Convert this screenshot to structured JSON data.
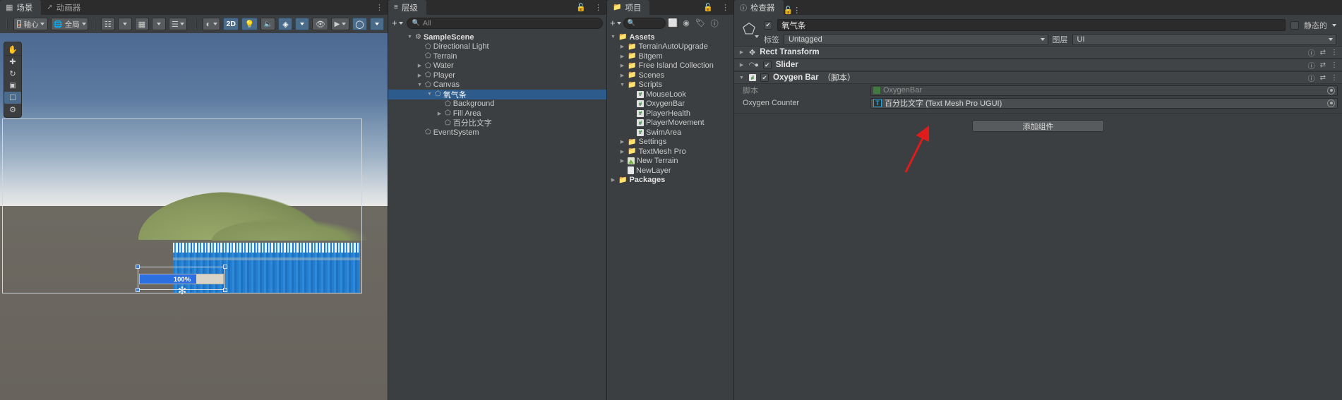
{
  "scene": {
    "tabs": [
      {
        "label": "场景",
        "icon": "grid-icon",
        "active": true
      },
      {
        "label": "动画器",
        "icon": "animator-icon",
        "active": false
      }
    ],
    "toolbar": {
      "pivot_label": "轴心",
      "global_label": "全局",
      "grid_icon": "grid-snap-icon",
      "snap_icon": "snap-increment-icon",
      "ruler_icon": "ruler-icon",
      "shading_icon": "shading-mode-icon",
      "twod_label": "2D",
      "light_icon": "lighting-icon",
      "audio_icon": "audio-mute-icon",
      "fx_icon": "effects-icon",
      "hidden_icon": "visibility-off-icon",
      "camera_icon": "scene-camera-icon",
      "gizmo_icon": "gizmos-icon"
    },
    "tools": [
      "hand-tool",
      "move-tool",
      "rotate-tool",
      "scale-tool",
      "rect-tool",
      "transform-tool"
    ],
    "slider_value": "100%",
    "menu_icon": "kebab-menu-icon"
  },
  "hierarchy": {
    "tab_label": "层级",
    "tab_icon": "hierarchy-icon",
    "add_label": "+",
    "search_placeholder": "All",
    "search_value": "",
    "lock_icon": "lock-icon",
    "menu_icon": "kebab-menu-icon",
    "items": [
      {
        "label": "SampleScene",
        "depth": 0,
        "tri": "down",
        "icon": "scene-icon",
        "bold": true,
        "selected": false
      },
      {
        "label": "Directional Light",
        "depth": 1,
        "tri": "none",
        "icon": "gameobject-icon",
        "selected": false
      },
      {
        "label": "Terrain",
        "depth": 1,
        "tri": "none",
        "icon": "gameobject-icon",
        "selected": false
      },
      {
        "label": "Water",
        "depth": 1,
        "tri": "right",
        "icon": "gameobject-icon",
        "selected": false
      },
      {
        "label": "Player",
        "depth": 1,
        "tri": "right",
        "icon": "gameobject-icon",
        "selected": false
      },
      {
        "label": "Canvas",
        "depth": 1,
        "tri": "down",
        "icon": "gameobject-icon",
        "selected": false
      },
      {
        "label": "氧气条",
        "depth": 2,
        "tri": "down",
        "icon": "gameobject-icon",
        "selected": true
      },
      {
        "label": "Background",
        "depth": 3,
        "tri": "none",
        "icon": "gameobject-icon",
        "selected": false
      },
      {
        "label": "Fill Area",
        "depth": 3,
        "tri": "right",
        "icon": "gameobject-icon",
        "selected": false
      },
      {
        "label": "百分比文字",
        "depth": 3,
        "tri": "none",
        "icon": "gameobject-icon",
        "selected": false
      },
      {
        "label": "EventSystem",
        "depth": 1,
        "tri": "none",
        "icon": "gameobject-icon",
        "selected": false
      }
    ]
  },
  "project": {
    "tab_label": "项目",
    "tab_icon": "folder-icon",
    "add_label": "+",
    "search_placeholder": "",
    "search_value": "",
    "lock_icon": "lock-icon",
    "menu_icon": "kebab-menu-icon",
    "toolbar_icons": [
      "filter-type-icon",
      "filter-label-icon",
      "console-warning-icon"
    ],
    "items": [
      {
        "label": "Assets",
        "depth": 0,
        "tri": "down",
        "icon": "folder-icon",
        "bold": true
      },
      {
        "label": "TerrainAutoUpgrade",
        "depth": 1,
        "tri": "right",
        "icon": "folder-icon"
      },
      {
        "label": "Bitgem",
        "depth": 1,
        "tri": "right",
        "icon": "folder-icon"
      },
      {
        "label": "Free Island Collection",
        "depth": 1,
        "tri": "right",
        "icon": "folder-icon"
      },
      {
        "label": "Scenes",
        "depth": 1,
        "tri": "right",
        "icon": "folder-icon"
      },
      {
        "label": "Scripts",
        "depth": 1,
        "tri": "down",
        "icon": "folder-icon"
      },
      {
        "label": "MouseLook",
        "depth": 2,
        "tri": "none",
        "icon": "csharp-script-icon"
      },
      {
        "label": "OxygenBar",
        "depth": 2,
        "tri": "none",
        "icon": "csharp-script-icon"
      },
      {
        "label": "PlayerHealth",
        "depth": 2,
        "tri": "none",
        "icon": "csharp-script-icon"
      },
      {
        "label": "PlayerMovement",
        "depth": 2,
        "tri": "none",
        "icon": "csharp-script-icon"
      },
      {
        "label": "SwimArea",
        "depth": 2,
        "tri": "none",
        "icon": "csharp-script-icon"
      },
      {
        "label": "Settings",
        "depth": 1,
        "tri": "right",
        "icon": "folder-icon"
      },
      {
        "label": "TextMesh Pro",
        "depth": 1,
        "tri": "right",
        "icon": "folder-icon"
      },
      {
        "label": "New Terrain",
        "depth": 1,
        "tri": "right",
        "icon": "terrain-asset-icon"
      },
      {
        "label": "NewLayer",
        "depth": 1,
        "tri": "none",
        "icon": "file-asset-icon"
      },
      {
        "label": "Packages",
        "depth": 0,
        "tri": "right",
        "icon": "folder-icon",
        "bold": true
      }
    ]
  },
  "inspector": {
    "tab_label": "检查器",
    "tab_icon": "info-icon",
    "lock_icon": "lock-icon",
    "menu_icon": "kebab-menu-icon",
    "object_name": "氧气条",
    "enabled": true,
    "static_label": "静态的",
    "tag_label": "标签",
    "tag_value": "Untagged",
    "layer_label": "图层",
    "layer_value": "UI",
    "components": [
      {
        "name": "Rect Transform",
        "icon": "rect-transform-icon",
        "expanded": false,
        "has_checkbox": false
      },
      {
        "name": "Slider",
        "icon": "slider-component-icon",
        "expanded": false,
        "has_checkbox": true,
        "checked": true
      },
      {
        "name": "Oxygen Bar",
        "suffix": "（脚本）",
        "icon": "csharp-script-icon",
        "expanded": true,
        "has_checkbox": true,
        "checked": true
      }
    ],
    "properties": [
      {
        "label": "脚本",
        "value": "OxygenBar",
        "icon": "script-asset-icon",
        "dim": true
      },
      {
        "label": "Oxygen Counter",
        "value": "百分比文字 (Text Mesh Pro UGUI)",
        "icon": "tmp-text-icon",
        "dim": false
      }
    ],
    "add_component_label": "添加组件",
    "help_icon": "help-icon",
    "preset_icon": "preset-icon",
    "settings_icon": "kebab-menu-icon"
  },
  "colors": {
    "accent_blue": "#2d5c8c",
    "panel_bg": "#3c3f41",
    "toolbar_bg": "#3c3f41",
    "tab_bg": "#2c2c2c",
    "arrow_red": "#e01b1b",
    "slider_fill": "#2b6fe0"
  }
}
